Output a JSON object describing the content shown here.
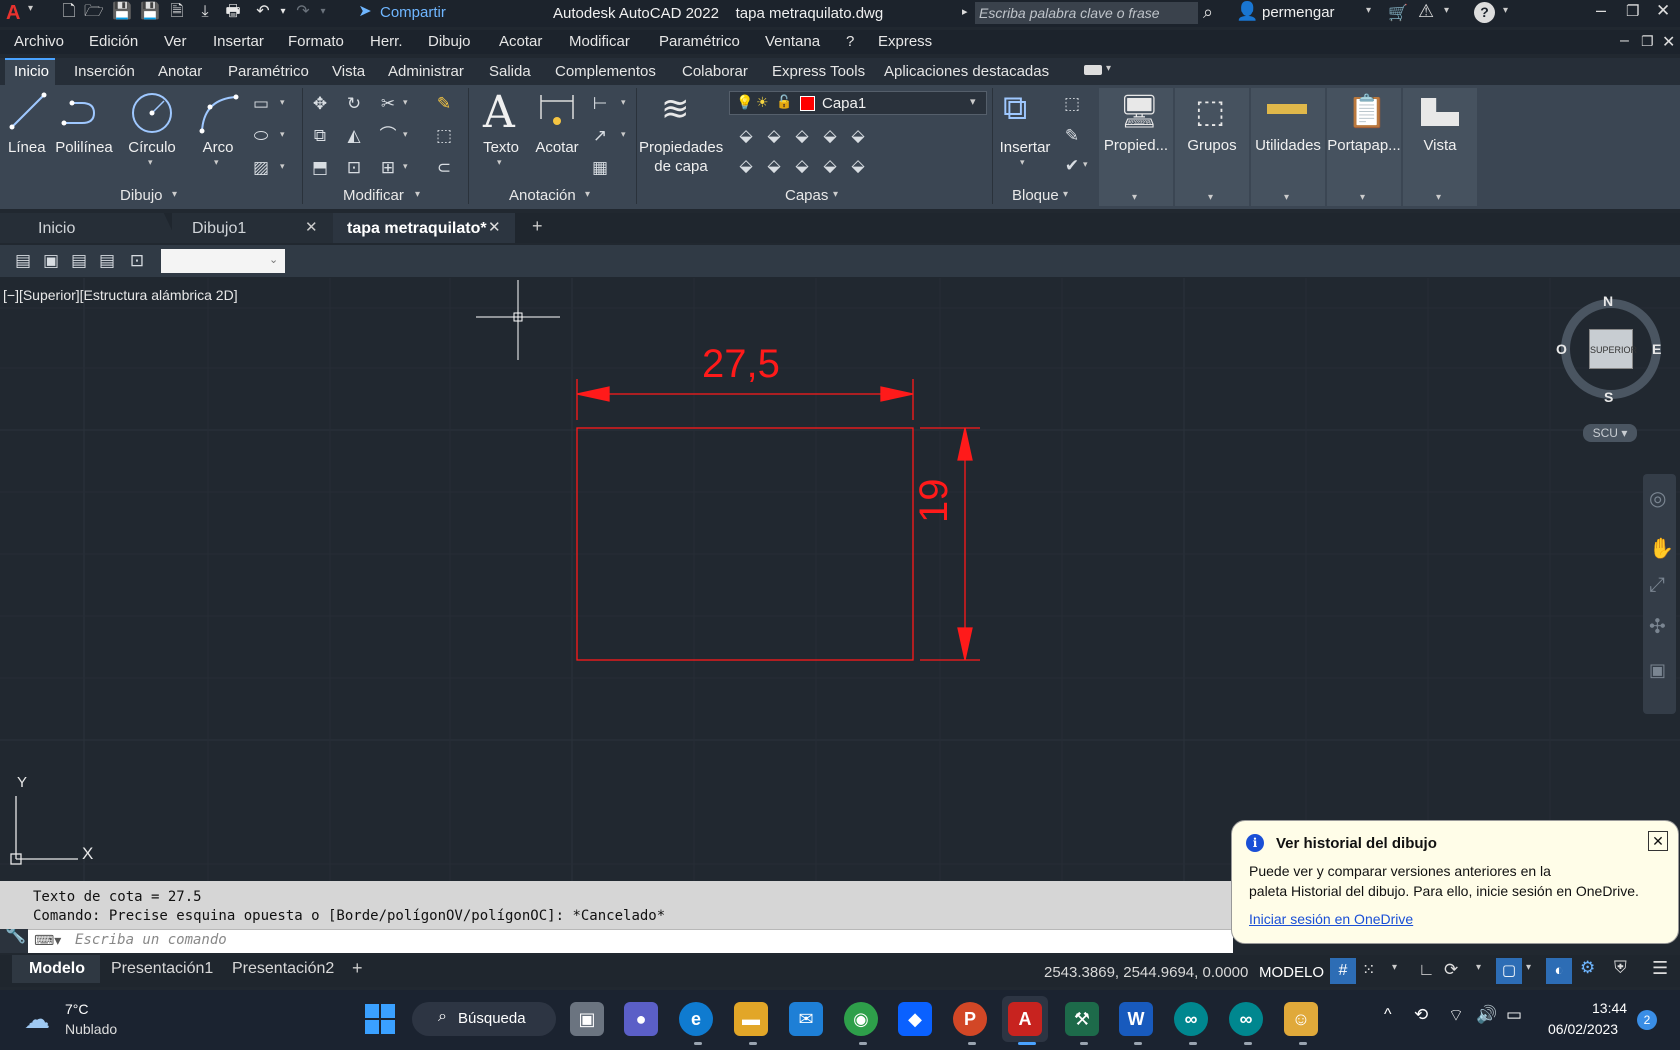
{
  "window": {
    "share_label": "Compartir",
    "title": "Autodesk AutoCAD 2022",
    "filename": "tapa metraquilato.dwg",
    "search_placeholder": "Escriba palabra clave o frase",
    "user": "permengar"
  },
  "menubar": [
    "Archivo",
    "Edición",
    "Ver",
    "Insertar",
    "Formato",
    "Herr.",
    "Dibujo",
    "Acotar",
    "Modificar",
    "Paramétrico",
    "Ventana",
    "?",
    "Express"
  ],
  "ribbon_tabs": [
    "Inicio",
    "Inserción",
    "Anotar",
    "Paramétrico",
    "Vista",
    "Administrar",
    "Salida",
    "Complementos",
    "Colaborar",
    "Express Tools",
    "Aplicaciones destacadas"
  ],
  "ribbon": {
    "dibujo": {
      "title": "Dibujo",
      "linea": "Línea",
      "polilinea": "Polilínea",
      "circulo": "Círculo",
      "arco": "Arco"
    },
    "modificar": {
      "title": "Modificar"
    },
    "anotacion": {
      "title": "Anotación",
      "texto": "Texto",
      "acotar": "Acotar"
    },
    "capas": {
      "title": "Capas",
      "props_line1": "Propiedades",
      "props_line2": "de capa",
      "current_layer": "Capa1",
      "layer_color": "#ff0000"
    },
    "bloque": {
      "title": "Bloque",
      "insertar": "Insertar"
    },
    "propiedades": "Propied...",
    "grupos": "Grupos",
    "utilidades": "Utilidades",
    "portapapeles": "Portapap...",
    "vista": "Vista"
  },
  "file_tabs": [
    "Inicio",
    "Dibujo1",
    "tapa metraquilato*"
  ],
  "viewport_label": "[−][Superior][Estructura alámbrica 2D]",
  "drawing": {
    "width_dim": "27,5",
    "height_dim": "19",
    "entity_color": "#ff1a1a"
  },
  "viewcube": {
    "n": "N",
    "s": "S",
    "e": "E",
    "w": "O",
    "face": "SUPERIOR",
    "ucs": "SCU"
  },
  "ucs_icon": {
    "x": "X",
    "y": "Y"
  },
  "command": {
    "history": [
      "Texto de cota = 27.5",
      "Comando: Precise esquina opuesta o [Borde/polígonOV/polígonOC]: *Cancelado*"
    ],
    "input_placeholder": "Escriba un comando"
  },
  "layout_tabs": [
    "Modelo",
    "Presentación1",
    "Presentación2"
  ],
  "status": {
    "coords": "2543.3869, 2544.9694, 0.0000",
    "space": "MODELO"
  },
  "balloon": {
    "title": "Ver historial del dibujo",
    "line1": "Puede ver y comparar versiones anteriores en la",
    "line2": "paleta Historial del dibujo. Para ello, inicie sesión en OneDrive.",
    "link": "Iniciar sesión en OneDrive"
  },
  "taskbar": {
    "temp": "7°C",
    "weather": "Nublado",
    "search": "Búsqueda",
    "time": "13:44",
    "date": "06/02/2023",
    "notifications": "2"
  }
}
